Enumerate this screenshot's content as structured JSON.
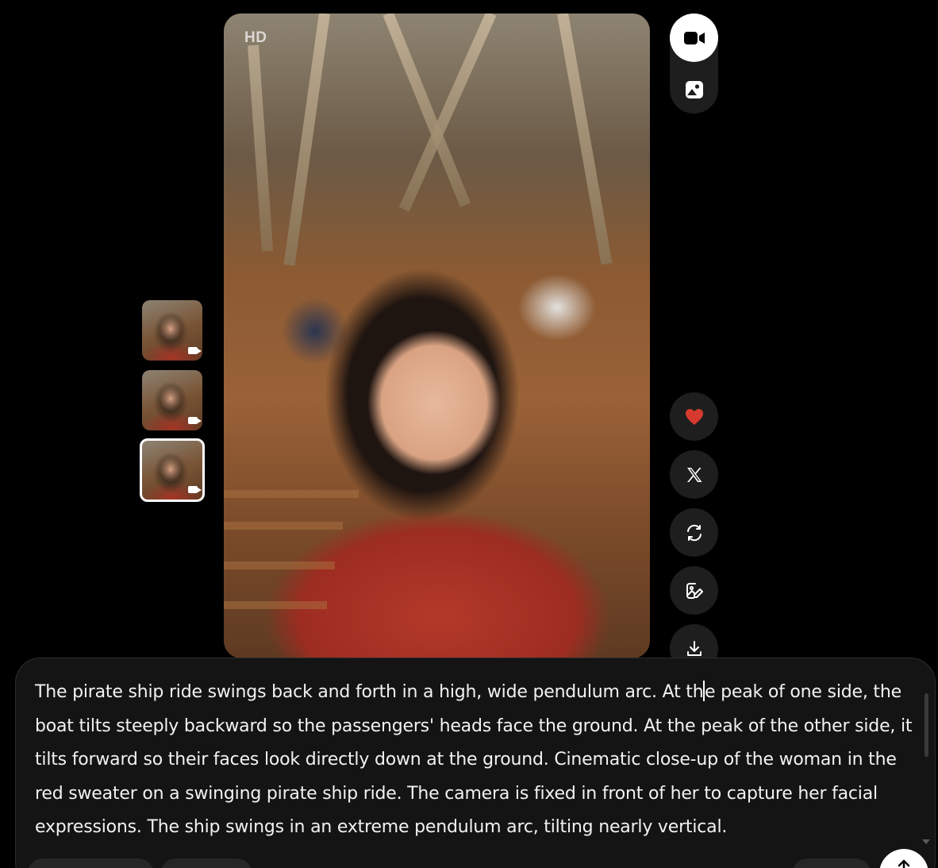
{
  "preview": {
    "quality_badge": "HD",
    "image_description_icon": "video-frame"
  },
  "thumbnails": [
    {
      "icon": "video-camera-icon",
      "selected": false
    },
    {
      "icon": "video-camera-icon",
      "selected": false
    },
    {
      "icon": "video-camera-icon",
      "selected": true
    }
  ],
  "mode_toggle": {
    "options": [
      {
        "icon": "video-camera-icon",
        "active": true
      },
      {
        "icon": "image-icon",
        "active": false
      }
    ]
  },
  "actions": [
    {
      "icon": "heart-icon",
      "color": "#d63a2f"
    },
    {
      "icon": "x-logo-icon"
    },
    {
      "icon": "refresh-icon"
    },
    {
      "icon": "edit-image-icon"
    },
    {
      "icon": "download-icon"
    }
  ],
  "composer": {
    "prompt_before_cursor": "The pirate ship ride swings back and forth in a high, wide pendulum arc. At th",
    "prompt_after_cursor": "e peak of one side, the boat tilts steeply backward so the passengers' heads face the ground. At the peak of the other side, it tilts forward so their faces look directly down at the ground. Cinematic close-up of the woman in the red sweater on a swinging pirate ship ride. The camera is fixed in front of her to capture her facial expressions. The ship swings in an extreme pendulum arc, tilting nearly vertical.",
    "send_icon": "arrow-up-icon"
  },
  "colors": {
    "background": "#000000",
    "panel": "#1e1e1e",
    "composer": "#141414",
    "accent_heart": "#d63a2f"
  }
}
